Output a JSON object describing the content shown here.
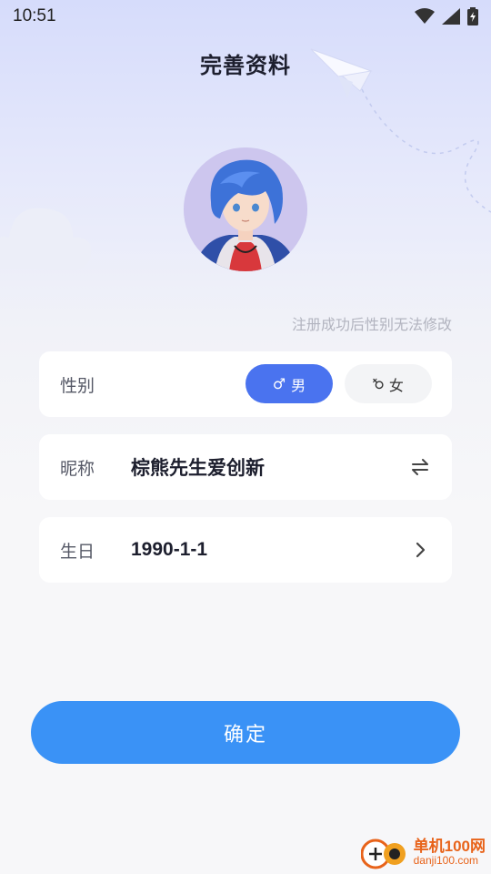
{
  "status_bar": {
    "time": "10:51"
  },
  "header": {
    "title": "完善资料"
  },
  "notice": "注册成功后性别无法修改",
  "gender": {
    "label": "性别",
    "male_label": "男",
    "female_label": "女",
    "selected": "male",
    "male_symbol": "♂",
    "female_symbol": "♀"
  },
  "nickname": {
    "label": "昵称",
    "value": "棕熊先生爱创新",
    "action_icon": "swap-icon"
  },
  "birthday": {
    "label": "生日",
    "value": "1990-1-1",
    "action_icon": "chevron-right-icon"
  },
  "confirm_label": "确定",
  "watermark": {
    "name": "单机100网",
    "url": "danji100.com"
  },
  "colors": {
    "accent": "#4a73ef",
    "confirm": "#3a92f6",
    "watermark": "#e8631a"
  }
}
